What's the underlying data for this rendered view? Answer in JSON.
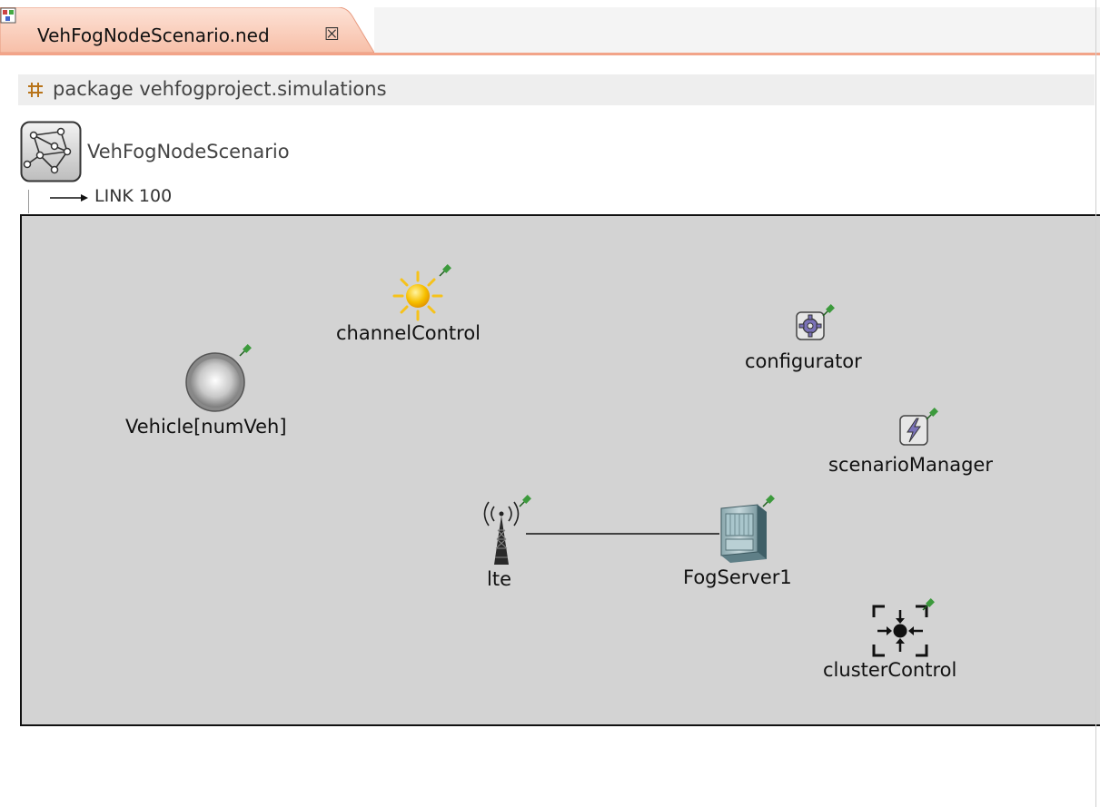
{
  "editor_tab": {
    "title": "VehFogNodeScenario.ned",
    "close_glyph": "☒"
  },
  "package": {
    "label": "package vehfogproject.simulations",
    "icon": "package-icon"
  },
  "network": {
    "name": "VehFogNodeScenario",
    "icon": "network-icon",
    "link_label": "LINK 100"
  },
  "canvas": {
    "background": "#d3d3d3",
    "nodes": {
      "channel_control": {
        "label": "channelControl",
        "icon": "sun-icon"
      },
      "configurator": {
        "label": "configurator",
        "icon": "gear-icon"
      },
      "vehicle": {
        "label": "Vehicle[numVeh]",
        "icon": "sphere-icon"
      },
      "scenario_manager": {
        "label": "scenarioManager",
        "icon": "lightning-icon"
      },
      "lte": {
        "label": "lte",
        "icon": "antenna-icon"
      },
      "fog_server": {
        "label": "FogServer1",
        "icon": "server-icon"
      },
      "cluster_control": {
        "label": "clusterControl",
        "icon": "cluster-icon"
      }
    },
    "connections": [
      {
        "from": "lte",
        "to": "FogServer1"
      }
    ]
  },
  "colors": {
    "tab_accent": "#f2a489",
    "pin_green": "#3c9a3c"
  }
}
